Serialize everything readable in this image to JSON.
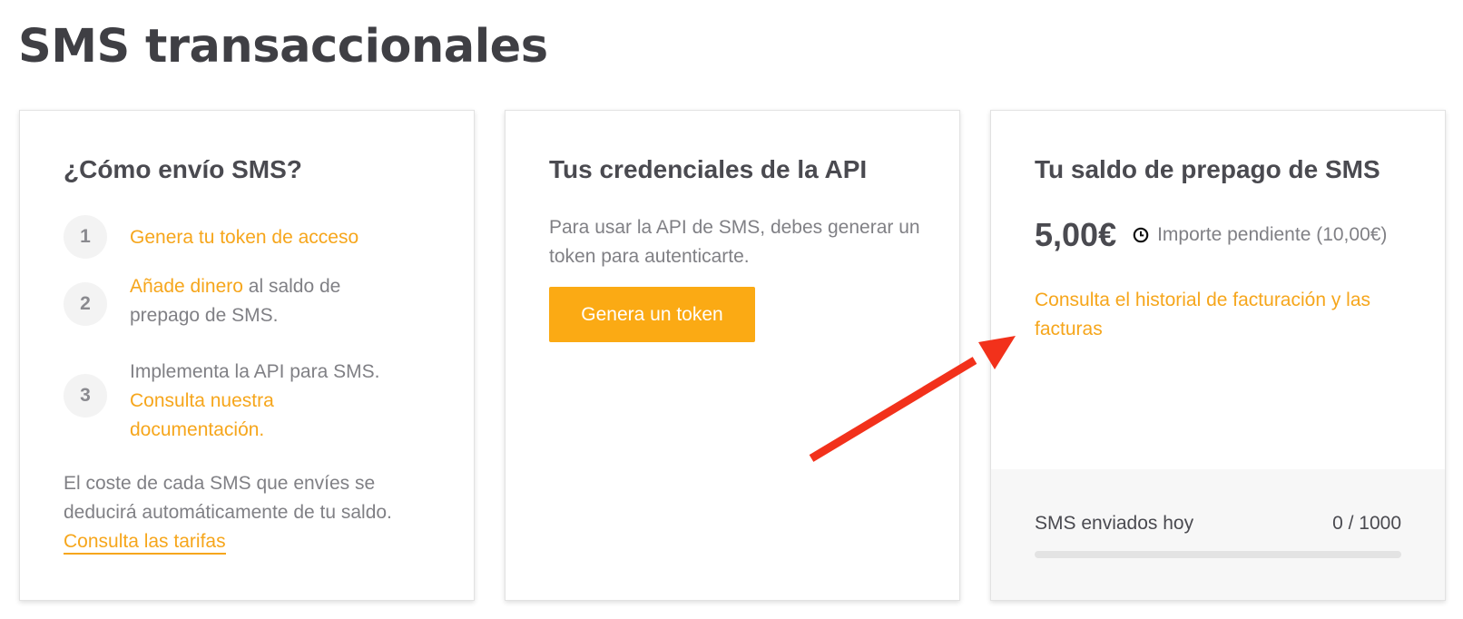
{
  "page": {
    "title": "SMS transaccionales"
  },
  "how_to": {
    "title": "¿Cómo envío SMS?",
    "steps": [
      {
        "number": "1",
        "link": "Genera tu token de acceso"
      },
      {
        "number": "2",
        "link": "Añade dinero",
        "text": " al saldo de prepago de SMS."
      },
      {
        "number": "3",
        "text": "Implementa la API para SMS. ",
        "link": "Consulta nuestra documentación."
      }
    ],
    "cost_note": "El coste de cada SMS que envíes se deducirá automáticamente de tu saldo. ",
    "rates_link": "Consulta las tarifas"
  },
  "api": {
    "title": "Tus credenciales de la API",
    "description": "Para usar la API de SMS, debes generar un token para autenticarte.",
    "button_label": "Genera un token"
  },
  "balance": {
    "title": "Tu saldo de prepago de SMS",
    "amount": "5,00€",
    "pending_icon": "clock-icon",
    "pending_text": "Importe pendiente (10,00€)",
    "history_link": "Consulta el historial de facturación y las facturas",
    "usage_label": "SMS enviados hoy",
    "usage_count": "0 / 1000",
    "usage_sent": 0,
    "usage_limit": 1000
  },
  "colors": {
    "accent": "#f6a61c",
    "button": "#fbaa14",
    "annotation_arrow": "#f2311b"
  }
}
